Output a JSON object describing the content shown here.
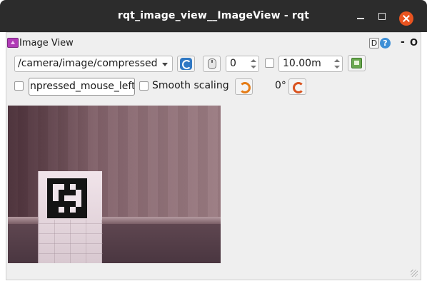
{
  "window": {
    "title": "rqt_image_view__ImageView - rqt"
  },
  "dock": {
    "title": "Image View",
    "d_label": "D",
    "help_label": "?",
    "dash_label": "-",
    "o_label": "O"
  },
  "toolbar": {
    "topic": "/camera/image/compressed",
    "spin_value": "0",
    "zoom_value": "10.00m"
  },
  "options": {
    "mouse_topic_value": "npressed_mouse_left",
    "smooth_label": "Smooth scaling",
    "angle_label": "0°"
  },
  "icons": {
    "refresh": "refresh-icon",
    "mouse": "mouse-icon",
    "save": "save-icon",
    "rotate_left": "rotate-left-icon",
    "rotate_right": "rotate-right-icon"
  },
  "colors": {
    "titlebar": "#2c2c2c",
    "close_button": "#e95420",
    "plugin_icon": "#b03bb6",
    "help_icon": "#3d8fd6"
  }
}
